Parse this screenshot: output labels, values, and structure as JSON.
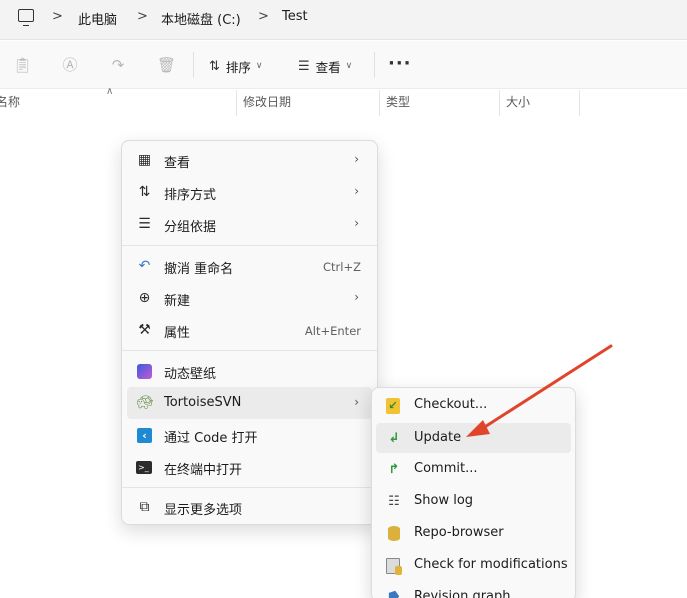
{
  "addressbar": {
    "crumbs": [
      "此电脑",
      "本地磁盘 (C:)",
      "Test"
    ],
    "separator": ">"
  },
  "toolbar": {
    "sort_label": "排序",
    "view_label": "查看",
    "more_label": "···"
  },
  "columns": {
    "name": "名称",
    "modified": "修改日期",
    "type": "类型",
    "size": "大小"
  },
  "context_menu": {
    "items": [
      {
        "label": "查看",
        "shortcut": "",
        "has_submenu": true,
        "icon": "grid-icon"
      },
      {
        "label": "排序方式",
        "shortcut": "",
        "has_submenu": true,
        "icon": "sort-icon"
      },
      {
        "label": "分组依据",
        "shortcut": "",
        "has_submenu": true,
        "icon": "group-icon"
      },
      {
        "label": "撤消 重命名",
        "shortcut": "Ctrl+Z",
        "has_submenu": false,
        "icon": "undo-icon"
      },
      {
        "label": "新建",
        "shortcut": "",
        "has_submenu": true,
        "icon": "plus-circle-icon"
      },
      {
        "label": "属性",
        "shortcut": "Alt+Enter",
        "has_submenu": false,
        "icon": "wrench-icon"
      },
      {
        "label": "动态壁纸",
        "shortcut": "",
        "has_submenu": false,
        "icon": "wallpaper-icon"
      },
      {
        "label": "TortoiseSVN",
        "shortcut": "",
        "has_submenu": true,
        "icon": "tortoise-icon"
      },
      {
        "label": "通过 Code 打开",
        "shortcut": "",
        "has_submenu": false,
        "icon": "vscode-icon"
      },
      {
        "label": "在终端中打开",
        "shortcut": "",
        "has_submenu": false,
        "icon": "terminal-icon"
      },
      {
        "label": "显示更多选项",
        "shortcut": "",
        "has_submenu": false,
        "icon": "more-options-icon"
      }
    ]
  },
  "svn_submenu": {
    "items": [
      {
        "label": "Checkout...",
        "icon": "checkout-icon"
      },
      {
        "label": "Update",
        "icon": "update-icon"
      },
      {
        "label": "Commit...",
        "icon": "commit-icon"
      },
      {
        "label": "Show log",
        "icon": "log-icon"
      },
      {
        "label": "Repo-browser",
        "icon": "repo-icon"
      },
      {
        "label": "Check for modifications",
        "icon": "modifications-icon"
      },
      {
        "label": "Revision graph",
        "icon": "graph-icon"
      }
    ]
  },
  "annotation": {
    "arrow_color": "#e0442a"
  }
}
